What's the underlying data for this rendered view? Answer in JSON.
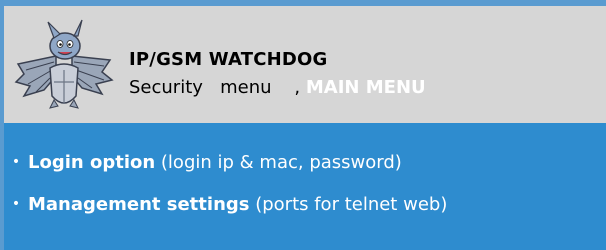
{
  "header": {
    "title": "IP/GSM WATCHDOG",
    "subtitle_prefix": "Security   menu    ,",
    "main_menu_link": "MAIN MENU",
    "logo_icon": "bat-dragon-mascot-icon"
  },
  "menu": {
    "bullet": "•",
    "items": [
      {
        "label": "Login option",
        "description": " (login ip & mac, password)"
      },
      {
        "label": "Management settings",
        "description": " (ports for telnet web)"
      }
    ]
  },
  "colors": {
    "header_bg": "#d6d6d6",
    "menu_bg": "#2e8ccf",
    "frame_border": "#5a9bd0",
    "menu_text": "#ffffff"
  }
}
